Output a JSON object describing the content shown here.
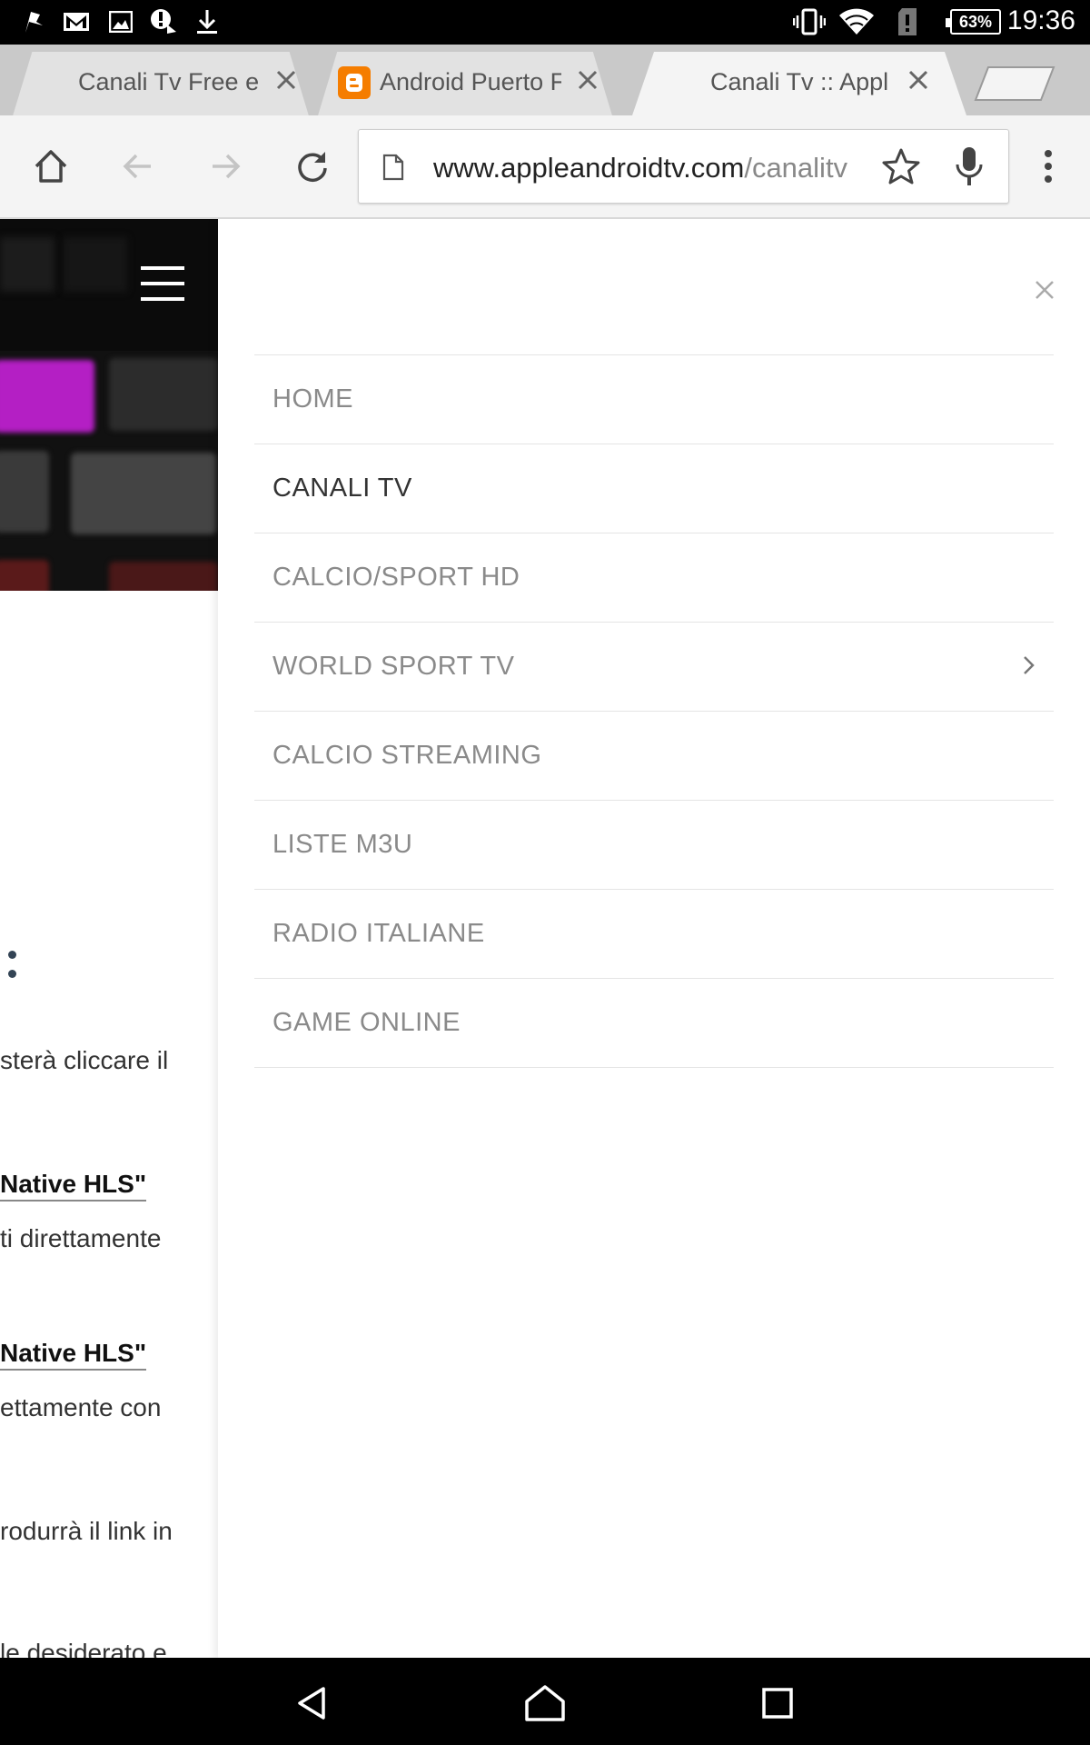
{
  "status_bar": {
    "time": "19:36",
    "battery": "63%",
    "left_icons": [
      "flag-icon",
      "gmail-icon",
      "image-icon",
      "alert-icon",
      "download-icon"
    ],
    "right_icons": [
      "vibrate-icon",
      "wifi-icon",
      "sim-alert-icon",
      "battery-icon"
    ]
  },
  "tabs": [
    {
      "title": "Canali Tv Free e",
      "favicon": ""
    },
    {
      "title": "Android Puerto F",
      "favicon": "blogger-icon"
    },
    {
      "title": "Canali Tv :: Appl",
      "favicon": ""
    }
  ],
  "toolbar": {
    "url_domain": "www.appleandroidtv.com",
    "url_path": "/canalitv"
  },
  "menu": {
    "items": [
      {
        "label": "HOME"
      },
      {
        "label": "CANALI TV"
      },
      {
        "label": "CALCIO/SPORT HD"
      },
      {
        "label": "WORLD SPORT TV",
        "has_submenu": true
      },
      {
        "label": "CALCIO STREAMING"
      },
      {
        "label": "LISTE M3U"
      },
      {
        "label": "RADIO ITALIANE"
      },
      {
        "label": "GAME ONLINE"
      }
    ],
    "active": "CANALI TV"
  },
  "background_page": {
    "text_1": "sterà cliccare il",
    "bold_1": "Native HLS\"",
    "text_2": "ti direttamente",
    "bold_2": "Native HLS\"",
    "text_3": "ettamente con",
    "text_4": "rodurrà il link in",
    "text_5": "le desiderato e"
  },
  "colors": {
    "blogger_orange": "#f57d00",
    "menu_text": "#8a8a8a",
    "menu_active_text": "#333333"
  }
}
